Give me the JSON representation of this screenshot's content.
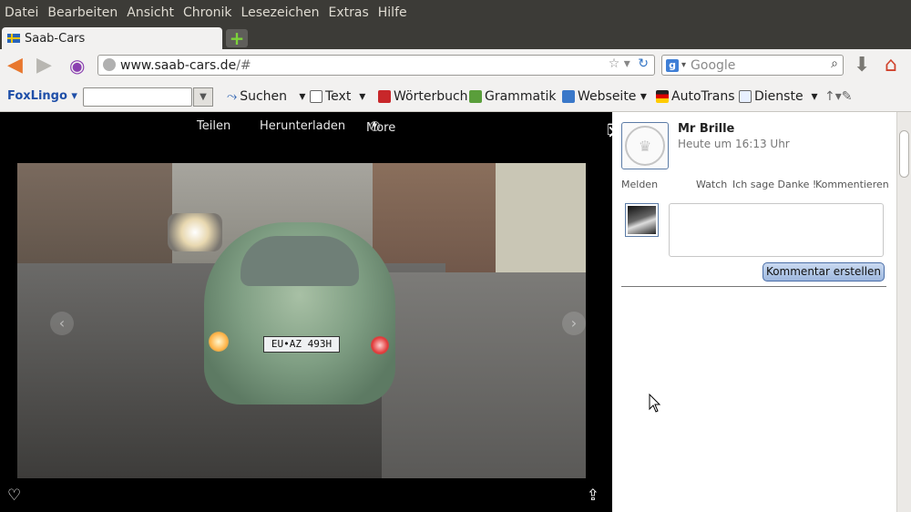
{
  "menubar": [
    "Datei",
    "Bearbeiten",
    "Ansicht",
    "Chronik",
    "Lesezeichen",
    "Extras",
    "Hilfe"
  ],
  "tab": {
    "title": "Saab-Cars"
  },
  "url": {
    "host": "www.saab-cars.de",
    "path": "/#"
  },
  "search": {
    "placeholder": "Google"
  },
  "toolbar": {
    "brand": "FoxLingo",
    "suchen": "Suchen",
    "text": "Text",
    "woerterbuch": "Wörterbuch",
    "grammatik": "Grammatik",
    "webseite": "Webseite",
    "autotrans": "AutoTrans",
    "dienste": "Dienste"
  },
  "viewer": {
    "share": "Teilen",
    "download": "Herunterladen",
    "more": "More",
    "plate": "EU•AZ 493H"
  },
  "panel": {
    "user": "Mr Brille",
    "time": "Heute um 16:13 Uhr",
    "actions": {
      "report": "Melden",
      "watch": "Watch",
      "thanks": "Ich sage Danke !",
      "comment": "Kommentieren"
    },
    "submit": "Kommentar erstellen"
  },
  "colors": {
    "accent": "#2f72c4",
    "brand_red": "#d83a16",
    "brand_blue": "#1f4fa8"
  }
}
